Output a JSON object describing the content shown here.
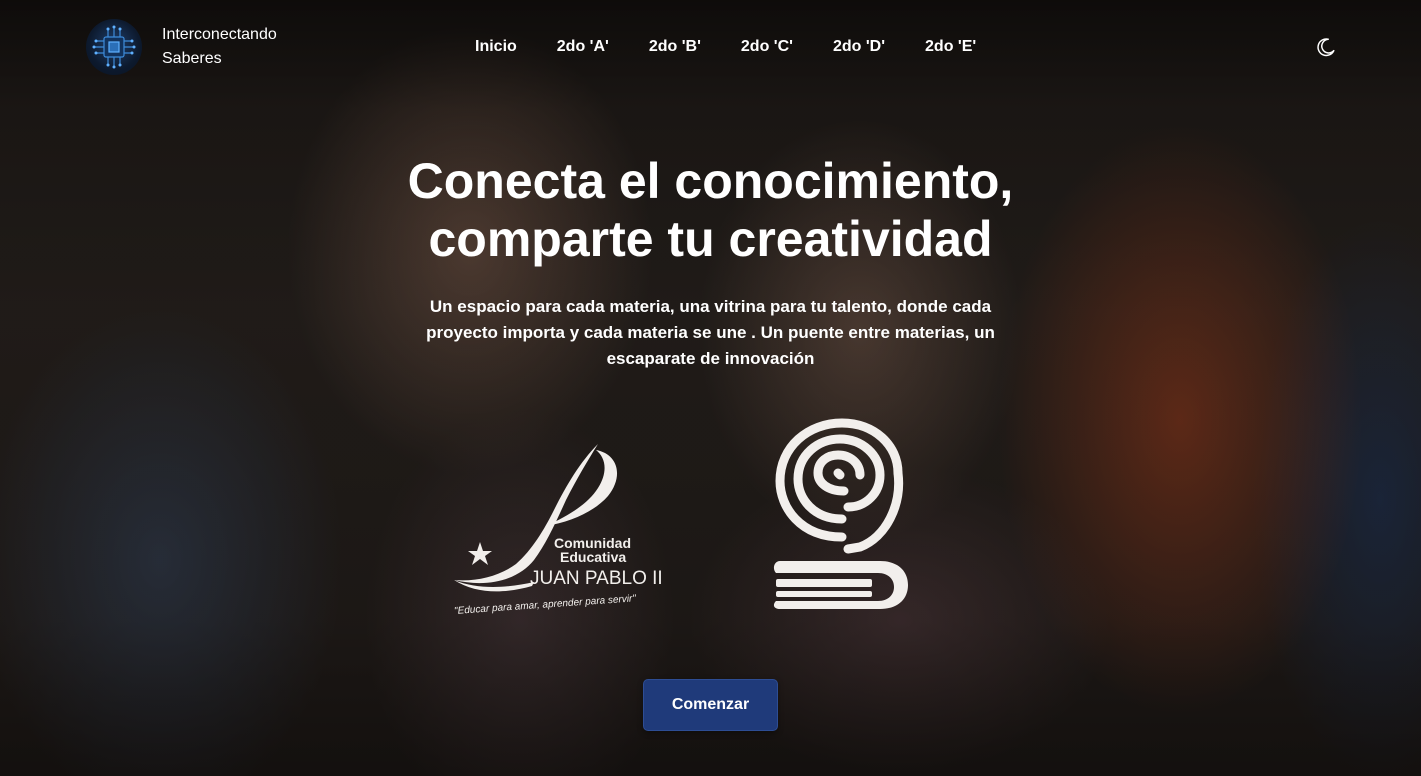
{
  "brand": {
    "line1": "Interconectando",
    "line2": "Saberes",
    "logo_icon": "circuit-chip-icon"
  },
  "nav": {
    "items": [
      {
        "label": "Inicio"
      },
      {
        "label": "2do 'A'"
      },
      {
        "label": "2do 'B'"
      },
      {
        "label": "2do 'C'"
      },
      {
        "label": "2do 'D'"
      },
      {
        "label": "2do 'E'"
      }
    ],
    "theme_icon": "moon-icon"
  },
  "hero": {
    "title_line1": "Conecta el conocimiento,",
    "title_line2": "comparte tu creatividad",
    "subtitle": "Un espacio para cada materia, una vitrina para tu talento, donde cada proyecto importa y cada materia se une . Un puente entre materias, un escaparate de innovación",
    "cta_label": "Comenzar"
  },
  "logos": {
    "school": {
      "line1": "Comunidad",
      "line2": "Educativa",
      "line3": "JUAN PABLO II",
      "motto": "\"Educar para amar, aprender para servir\""
    }
  },
  "colors": {
    "cta_bg": "#1f3a7a",
    "text": "#ffffff",
    "logo_fill": "#f2efec"
  }
}
